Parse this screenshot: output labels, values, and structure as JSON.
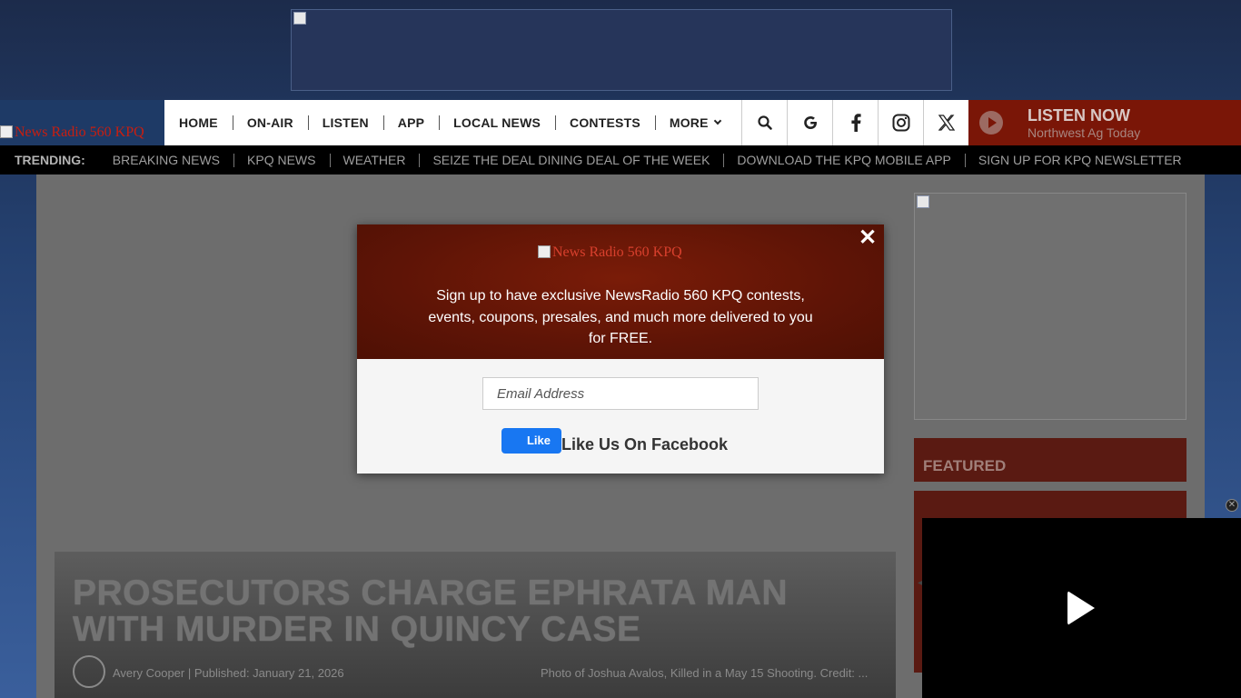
{
  "header": {
    "logo_alt": "News Radio 560 KPQ",
    "nav": [
      {
        "label": "HOME"
      },
      {
        "label": "ON-AIR"
      },
      {
        "label": "LISTEN"
      },
      {
        "label": "APP"
      },
      {
        "label": "LOCAL NEWS"
      },
      {
        "label": "CONTESTS"
      },
      {
        "label": "MORE"
      }
    ],
    "icons": [
      "search-icon",
      "google-icon",
      "facebook-icon",
      "instagram-icon",
      "x-icon"
    ],
    "listen": {
      "title": "LISTEN NOW",
      "subtitle": "Northwest Ag Today"
    }
  },
  "trending": {
    "label": "TRENDING:",
    "items": [
      "BREAKING NEWS",
      "KPQ NEWS",
      "WEATHER",
      "SEIZE THE DEAL DINING DEAL OF THE WEEK",
      "DOWNLOAD THE KPQ MOBILE APP",
      "SIGN UP FOR KPQ NEWSLETTER"
    ]
  },
  "article": {
    "title": "PROSECUTORS CHARGE EPHRATA MAN WITH MURDER IN QUINCY CASE",
    "author_line": "Avery Cooper | Published: January 21, 2026",
    "caption": "Photo of Joshua Avalos, Killed in a May 15 Shooting. Credit: ..."
  },
  "sidebar": {
    "featured_label": "FEATURED"
  },
  "modal": {
    "logo_alt": "News Radio 560 KPQ",
    "close_symbol": "✕",
    "text": "Sign up to have exclusive NewsRadio 560 KPQ contests, events, coupons, presales, and much more delivered to you for FREE.",
    "email_placeholder": "Email Address",
    "like_button": "Like",
    "like_label": "Like Us On Facebook"
  },
  "colors": {
    "brand_red": "#7a1607",
    "facebook_blue": "#1877f2",
    "trending_bg": "#000000"
  }
}
